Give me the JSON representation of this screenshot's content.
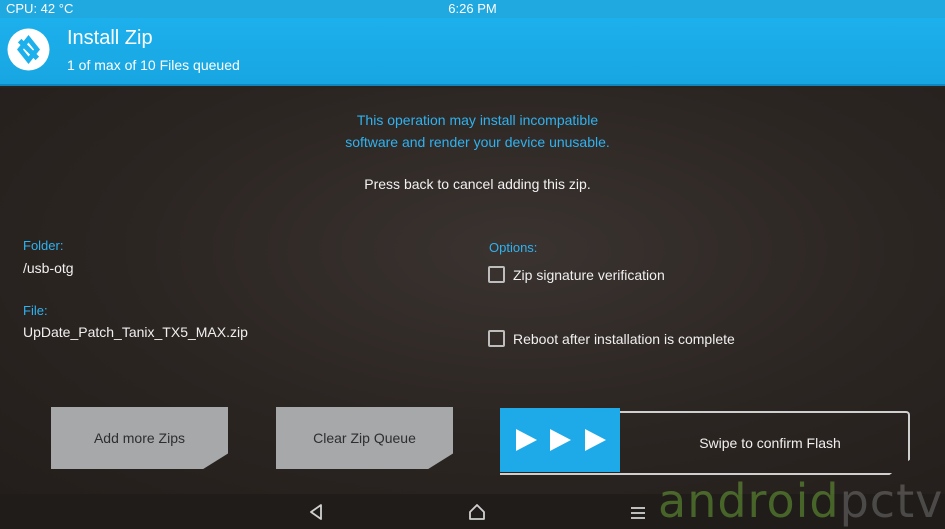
{
  "status_bar": {
    "cpu": "CPU: 42 °C",
    "time": "6:26 PM"
  },
  "header": {
    "title": "Install Zip",
    "subtitle": "1 of max of 10 Files queued",
    "logo_icon": "twrp-logo-icon"
  },
  "warning": {
    "line1": "This operation may install incompatible",
    "line2": "software and render your device unusable.",
    "press_back": "Press back to cancel adding this zip."
  },
  "folder": {
    "label": "Folder:",
    "value": "/usb-otg"
  },
  "file": {
    "label": "File:",
    "value": "UpDate_Patch_Tanix_TX5_MAX.zip"
  },
  "options": {
    "label": "Options:",
    "items": [
      {
        "label": "Zip signature verification",
        "checked": false
      },
      {
        "label": "Reboot after installation is complete",
        "checked": false
      }
    ]
  },
  "buttons": {
    "add_more": "Add more Zips",
    "clear_queue": "Clear Zip Queue"
  },
  "swipe": {
    "label": "Swipe to confirm Flash",
    "icon": "triple-play-arrow-icon"
  },
  "nav": {
    "back_icon": "back-triangle-icon",
    "home_icon": "home-icon",
    "menu_icon": "menu-lines-icon"
  },
  "watermark": {
    "part1": "android",
    "part2": "pctv"
  },
  "colors": {
    "accent": "#1eaae8",
    "button": "#a6a8aa",
    "background": "#2a2421"
  }
}
